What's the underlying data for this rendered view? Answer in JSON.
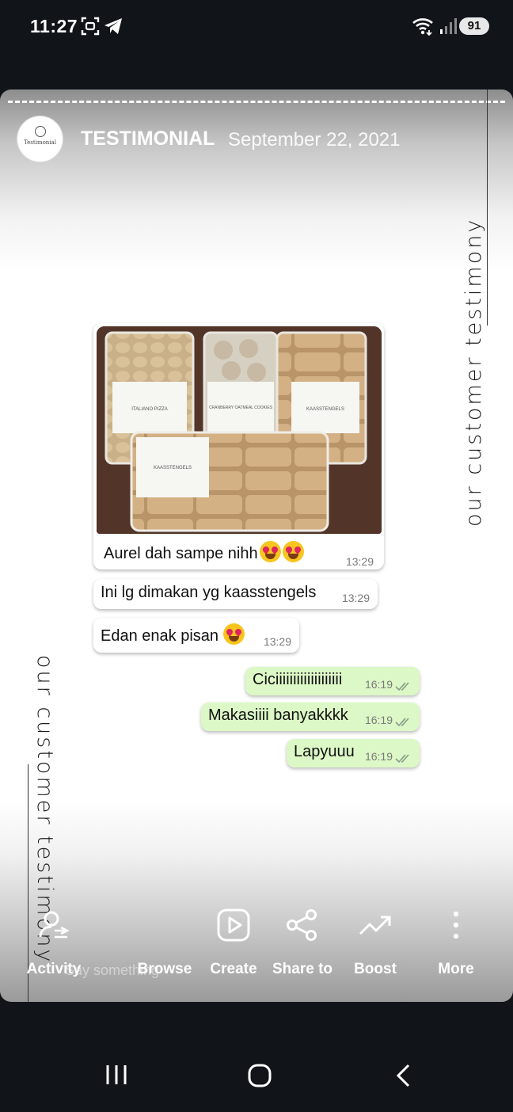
{
  "status_bar": {
    "time": "11:27",
    "battery": "91"
  },
  "story": {
    "avatar_text": "Testimonial",
    "account": "TESTIMONIAL",
    "date": "September 22, 2021",
    "side_text": "our customer testimony",
    "side_text_left": "our customer testimony",
    "photo_labels": [
      "ITALIANO PIZZA",
      "CRANBERRY OATMEAL COOKIES",
      "KAASSTENGELS",
      "KAASSTENGELS"
    ]
  },
  "chat": {
    "incoming": [
      {
        "text": "Aurel dah sampe nihh",
        "time": "13:29"
      },
      {
        "text": "Ini lg dimakan yg kaasstengels",
        "time": "13:29"
      },
      {
        "text": "Edan enak pisan",
        "time": "13:29"
      }
    ],
    "outgoing": [
      {
        "text": "Ciciiiiiiiiiiiiiiiiiii",
        "time": "16:19"
      },
      {
        "text": "Makasiiii banyakkkk",
        "time": "16:19"
      },
      {
        "text": "Lapyuuu",
        "time": "16:19"
      }
    ]
  },
  "actions": {
    "ghost_text": "Say something",
    "items": [
      {
        "label": "Activity",
        "icon": "activity-icon"
      },
      {
        "label": "Browse",
        "icon": "browse-icon"
      },
      {
        "label": "Create",
        "icon": "create-icon"
      },
      {
        "label": "Share to",
        "icon": "share-icon"
      },
      {
        "label": "Boost",
        "icon": "boost-icon"
      },
      {
        "label": "More",
        "icon": "more-icon"
      }
    ]
  },
  "colors": {
    "outgoing_bubble": "#dcf8c6",
    "incoming_bubble": "#ffffff",
    "background": "#111418"
  }
}
